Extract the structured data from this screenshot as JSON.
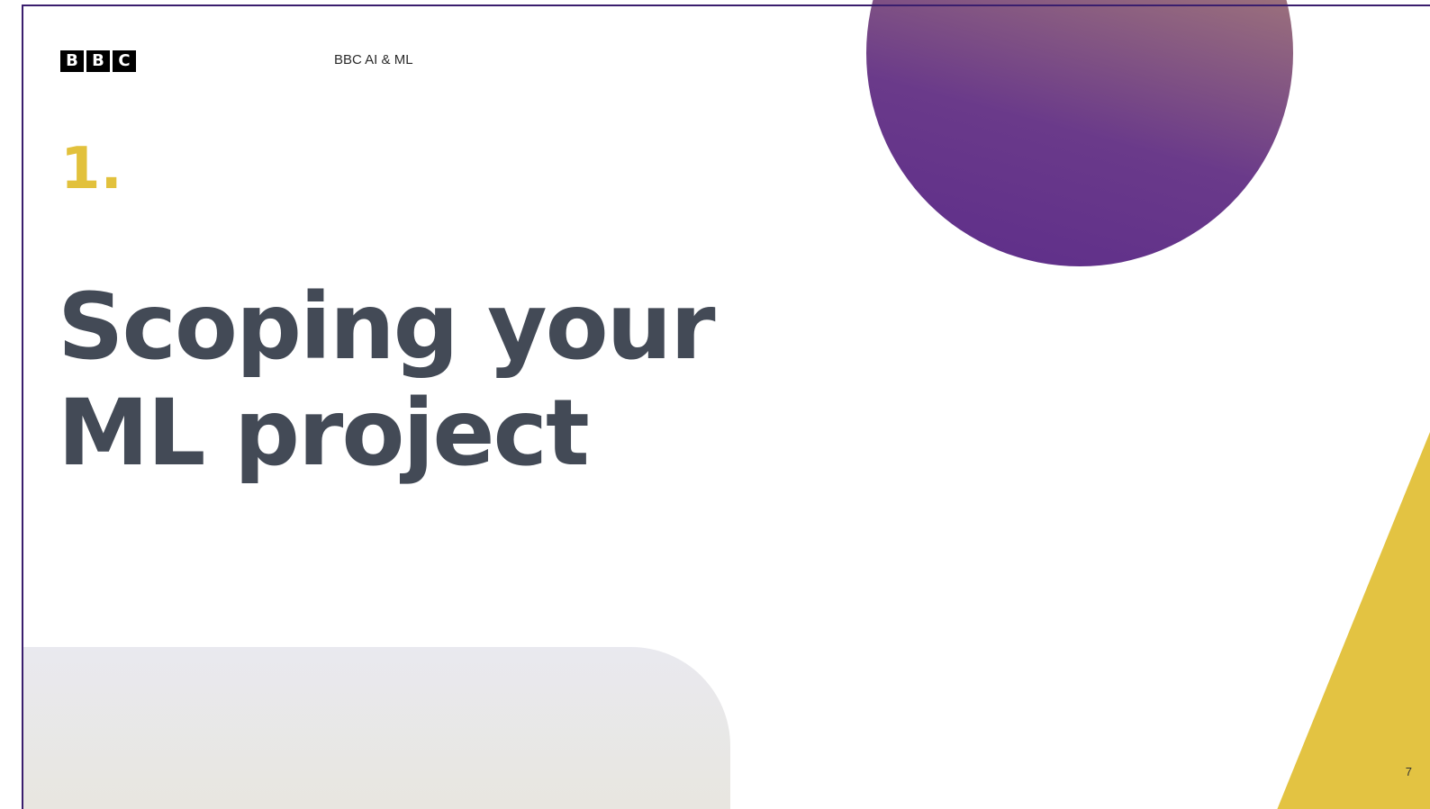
{
  "header": {
    "logo_letters": [
      "B",
      "B",
      "C"
    ],
    "label": "BBC AI & ML"
  },
  "section": {
    "number": "1."
  },
  "title": {
    "line1": "Scoping your",
    "line2": "ML project"
  },
  "footer": {
    "page_number": "7"
  },
  "colors": {
    "accent_yellow": "#e2c13c",
    "title_text": "#434a56",
    "frame_purple": "#3a1e6e",
    "circle_purple": "#5d2d8a",
    "circle_gold": "#c2985c"
  }
}
